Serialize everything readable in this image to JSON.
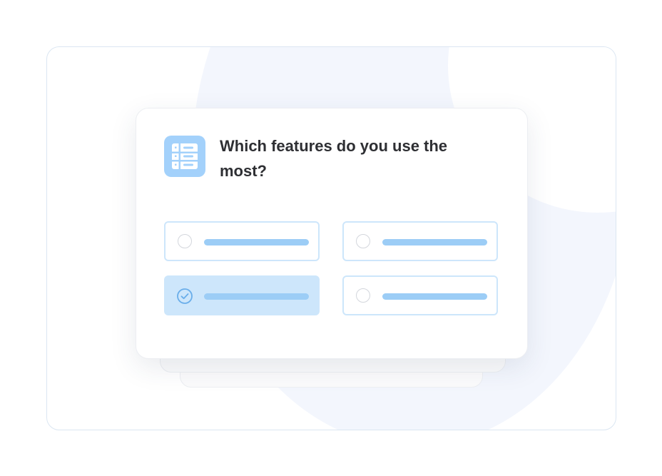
{
  "question": {
    "icon": "table-list-icon",
    "text": "Which features do you use the most?"
  },
  "options": [
    {
      "selected": false,
      "icon": "radio-empty-icon"
    },
    {
      "selected": false,
      "icon": "radio-empty-icon"
    },
    {
      "selected": true,
      "icon": "check-circle-icon"
    },
    {
      "selected": false,
      "icon": "radio-empty-icon"
    }
  ],
  "colors": {
    "accent": "#a3d1fb",
    "option_border": "#cde6fb",
    "selected_fill": "#cde6fb",
    "placeholder_bar": "#9ccdf6",
    "title_text": "#2e2f33",
    "background_blob": "#f3f6fd"
  }
}
